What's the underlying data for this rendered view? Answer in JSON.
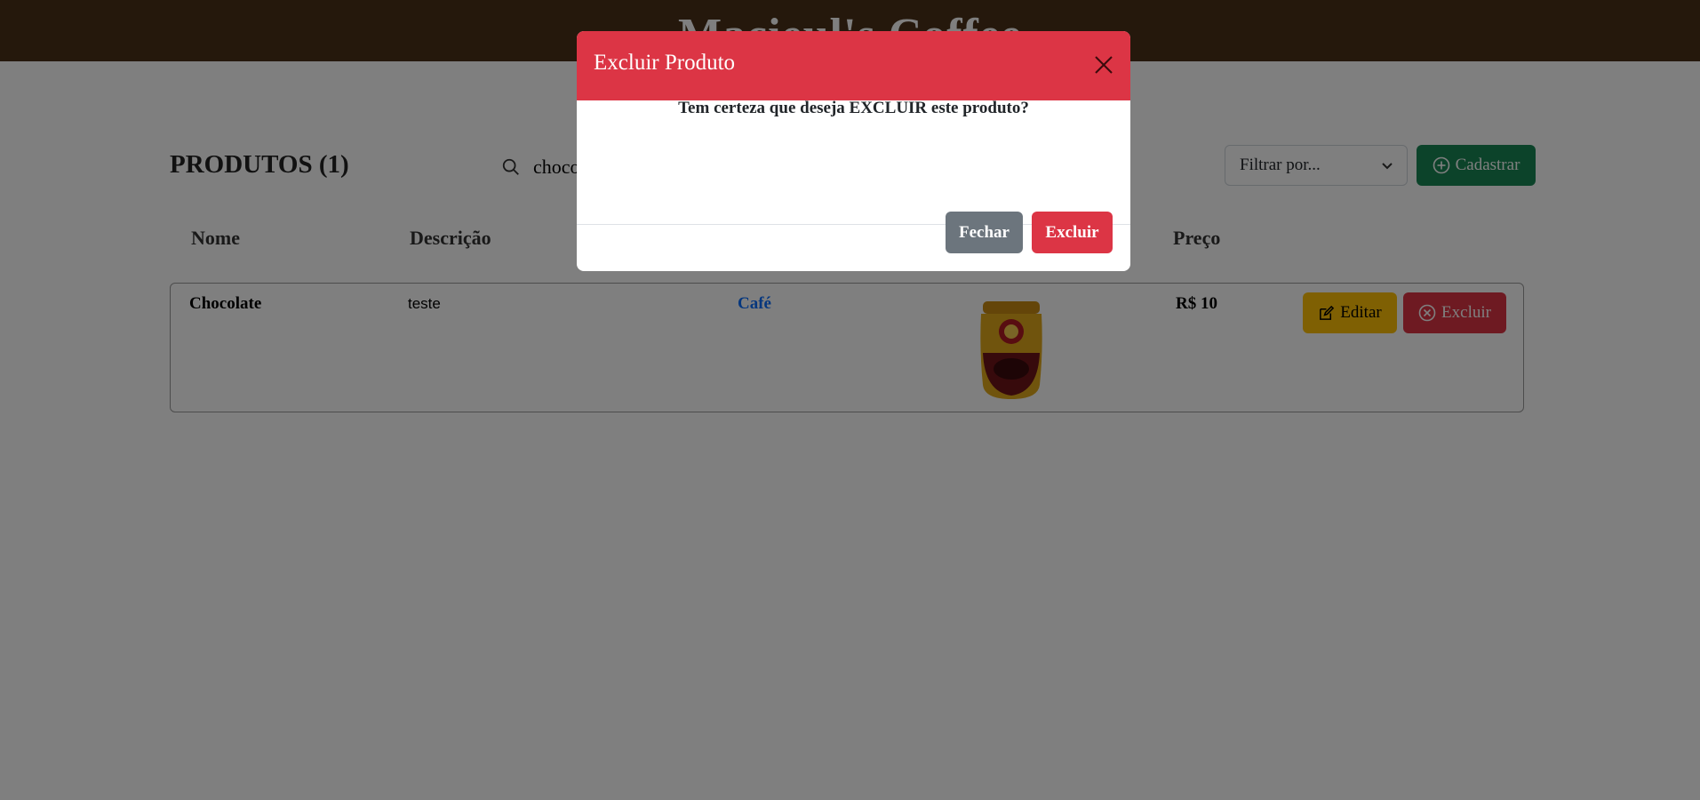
{
  "header": {
    "brand": "Macieul's Coffee"
  },
  "toolbar": {
    "title": "PRODUTOS (1)",
    "search_value": "choco",
    "filter_label": "Filtrar por...",
    "cadastrar_label": "Cadastrar"
  },
  "table": {
    "headers": [
      "Nome",
      "Descrição",
      "",
      "",
      "Preço"
    ],
    "rows": [
      {
        "nome": "Chocolate",
        "descricao": "teste",
        "categoria": "Café",
        "preco": "R$ 10",
        "editar_label": "Editar",
        "excluir_label": "Excluir"
      }
    ]
  },
  "modal": {
    "title": "Excluir Produto",
    "message": "Tem certeza que deseja EXCLUIR este produto?",
    "fechar_label": "Fechar",
    "excluir_label": "Excluir"
  },
  "colors": {
    "header_bg": "#4a3018",
    "danger": "#dc3545",
    "success": "#198754",
    "warning": "#ffc107",
    "secondary": "#6c757d",
    "link": "#0d6efd"
  },
  "icons": {
    "search": "search-icon",
    "chevron": "chevron-down-icon",
    "plus": "plus-circle-icon",
    "edit": "edit-icon",
    "delete": "x-circle-icon",
    "close": "close-icon"
  }
}
